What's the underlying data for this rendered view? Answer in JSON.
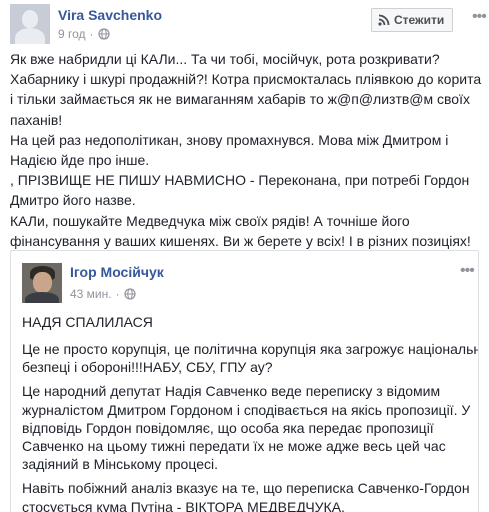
{
  "post": {
    "author": "Vira Savchenko",
    "time": "9 год",
    "follow_label": "Стежити",
    "text_lines": [
      "Як вже набридли ці КАЛи... Та чи тобі, мосійчук, рота розкривати?",
      "Хабарнику і шкурі продажній?! Котра присмокталась пліявкою до корита",
      "і тільки займається як не вимаганням хабарів то ж@п@лизтв@м своїх",
      "паханів!",
      "На цей раз недополітикан, знову промахнувся. Мова між Дмитром і",
      "Надією йде про інше.",
      ", ПРІЗВИЩЕ НЕ ПИШУ НАВМИСНО - Переконана, при потребі Гордон",
      "Дмитро його назве.",
      "КАЛи, пошукайте Медведчука між своїх рядів! А точніше його",
      "фінансування у ваших кишенях. Ви ж берете у всіх! І в різних позиціях!"
    ]
  },
  "shared": {
    "author": "Ігор Мосійчук",
    "time": "43 мин.",
    "headline": "НАДЯ СПАЛИЛАСЯ",
    "paragraphs": [
      [
        "Це не просто корупція, це політична корупція яка загрожує національній",
        "безпеці і обороні!!!НАБУ, СБУ, ГПУ ау?"
      ],
      [
        "Це народний депутат Надія Савченко веде переписку з відомим",
        "журналістом Дмитром Гордоном і сподівається на якісь пропозиції. У",
        "відповідь Гордон повідомляє, що особа яка передає пропозиції",
        "Савченко на цьому тижні передати їх не може адже весь цей час",
        "задіяний в Мінському процесі."
      ],
      [
        "Навіть побіжний аналіз вказує на те, що переписка Савченко-Гордон",
        "стосується кума Путіна - ВІКТОРА МЕДВЕДЧУКА."
      ]
    ]
  },
  "colors": {
    "name_link": "#365899",
    "meta_gray": "#90949c",
    "text": "#1d2129",
    "border": "#dddfe2"
  },
  "icons": {
    "privacy": "globe-icon",
    "follow": "rss-icon",
    "menu": "ellipsis-icon"
  }
}
